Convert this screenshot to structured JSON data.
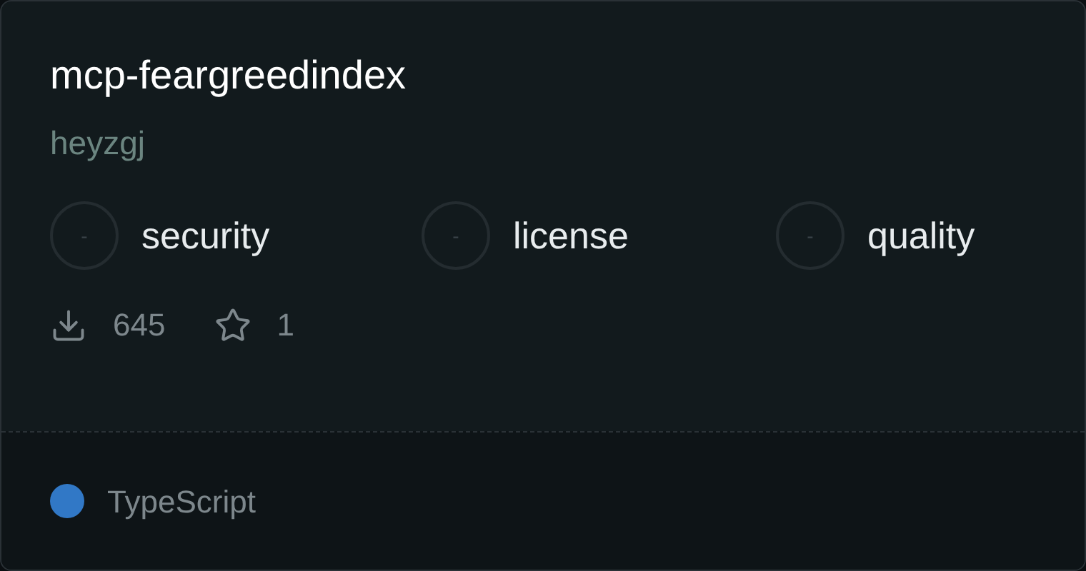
{
  "title": "mcp-feargreedindex",
  "author": "heyzgj",
  "badges": [
    {
      "label": "security",
      "score": "-"
    },
    {
      "label": "license",
      "score": "-"
    },
    {
      "label": "quality",
      "score": "-"
    }
  ],
  "stats": {
    "downloads": "645",
    "stars": "1"
  },
  "language": {
    "name": "TypeScript",
    "color": "#3178c6"
  }
}
